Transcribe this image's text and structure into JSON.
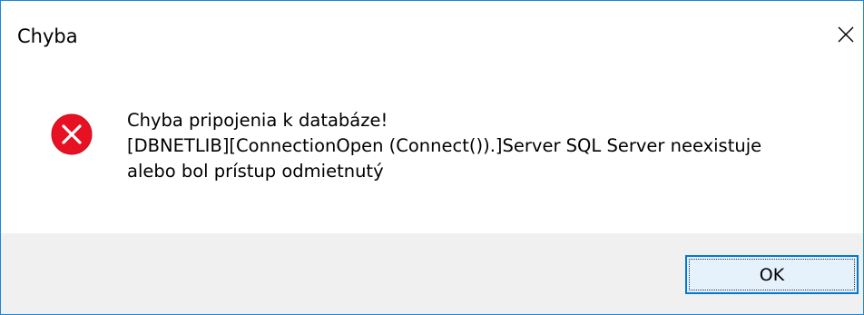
{
  "window": {
    "title": "Chyba",
    "border_color": "#1c86d9"
  },
  "icons": {
    "error": "error-x-circle-icon",
    "close": "close-icon"
  },
  "message": {
    "line1": "Chyba pripojenia k databáze!",
    "line2": "[DBNETLIB][ConnectionOpen (Connect()).]Server SQL Server neexistuje",
    "line3": "alebo bol prístup odmietnutý"
  },
  "buttons": {
    "ok_label": "OK"
  },
  "colors": {
    "error_red": "#e81123",
    "footer_bg": "#f0f0f0",
    "button_border": "#0078d7",
    "button_bg": "#e5f1fb"
  }
}
